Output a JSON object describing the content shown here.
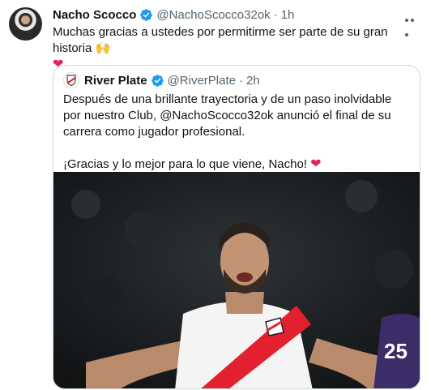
{
  "tweet": {
    "author_name": "Nacho Scocco",
    "author_handle": "@NachoScocco32ok",
    "separator": "·",
    "time": "1h",
    "text": "Muchas gracias a ustedes por permitirme ser parte de su gran historia",
    "emoji_hands": "🙌",
    "emoji_heart": "❤"
  },
  "quote": {
    "author_name": "River Plate",
    "author_handle": "@RiverPlate",
    "separator": "·",
    "time": "2h",
    "text_1": "Después de una brillante trayectoria y de un paso inolvidable por nuestro Club, @NachoScocco32ok anunció el final de su carrera como jugador profesional.",
    "text_2": "¡Gracias y lo mejor para lo que viene, Nacho!",
    "emoji_heart": "❤",
    "photo_jersey_number": "25"
  },
  "colors": {
    "verified": "#1d9bf0",
    "heart": "#e0245e",
    "river_red": "#e3202f"
  }
}
